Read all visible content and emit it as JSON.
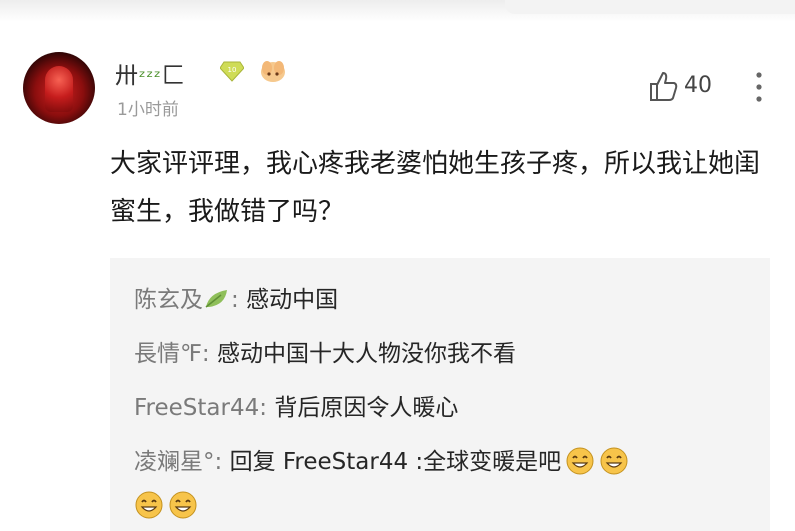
{
  "post": {
    "username": "卅",
    "username_suffix": "ᶻᶻᶻ",
    "username_end": "匚",
    "time": "1小时前",
    "likes": "40",
    "text": "大家评评理，我心疼我老婆怕她生孩子疼，所以我让她闺蜜生，我做错了吗？"
  },
  "replies": [
    {
      "author": "陈玄及",
      "sep": ": ",
      "text": "感动中国"
    },
    {
      "author": "長情℉",
      "sep": ": ",
      "text": "感动中国十大人物没你我不看"
    },
    {
      "author": "FreeStar44",
      "sep": ": ",
      "text": "背后原因令人暖心"
    },
    {
      "author": "凌斓星°",
      "sep": ": ",
      "text": "回复 FreeStar44 :全球变暖是吧"
    }
  ],
  "colors": {
    "accent": "#7a7a7a",
    "badge_gem": "#c8d84a"
  }
}
